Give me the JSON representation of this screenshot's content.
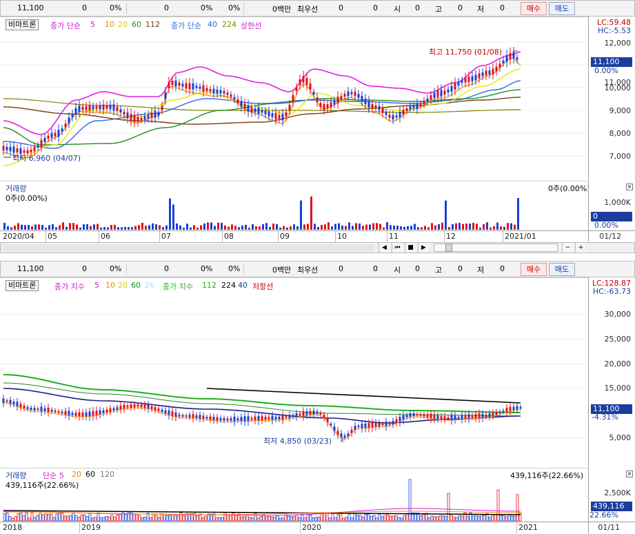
{
  "top": {
    "quote": {
      "price": "11,100",
      "chg": "0",
      "chg_pct": "0%",
      "vol": "0",
      "vol_pct": "0%",
      "pct2": "0%",
      "amount": "0백만",
      "best_bid_label": "최우선",
      "bid1": "0",
      "bid2": "0",
      "open_label": "시",
      "open": "0",
      "high_label": "고",
      "high": "0",
      "low_label": "저",
      "low": "0",
      "buy": "매수",
      "sell": "매도"
    },
    "legend": {
      "chart_type": "비마트론",
      "ma_label": "종가 단순",
      "ma5": "5",
      "ma10": "10",
      "ma20": "20",
      "ma60": "60",
      "ma112": "112",
      "ma2_label": "종가 단순",
      "ma40": "40",
      "ma224": "224",
      "upper": "상한선"
    },
    "lc": "LC:59.48",
    "hc": "HC:-5.53",
    "y_ticks": [
      "12,000",
      "11,000",
      "10,000",
      "9,000",
      "8,000",
      "7,000"
    ],
    "price_box": "11,100",
    "price_pct": "0.00%",
    "high_annot": "최고 11,750 (01/08)",
    "low_annot": "최저 6,960 (04/07)",
    "volume": {
      "title": "거래량",
      "left_val": "0주(0.00%)",
      "right_val": "0주(0.00%)",
      "tick": "1,000K",
      "box": "0",
      "pct": "0.00%"
    },
    "x_labels": [
      "2020/04",
      "05",
      "06",
      "07",
      "08",
      "09",
      "10",
      "11",
      "12",
      "2021/01"
    ],
    "date_box": "01/12",
    "scroll_buttons": [
      "◀",
      "⏮",
      "■",
      "▶",
      "−",
      "+"
    ]
  },
  "bottom": {
    "quote": {
      "price": "11,100",
      "chg": "0",
      "chg_pct": "0%",
      "vol": "0",
      "vol_pct": "0%",
      "pct2": "0%",
      "amount": "0백만",
      "best_bid_label": "최우선",
      "bid1": "0",
      "bid2": "0",
      "open_label": "시",
      "open": "0",
      "high_label": "고",
      "high": "0",
      "low_label": "저",
      "low": "0",
      "buy": "매수",
      "sell": "매도"
    },
    "legend": {
      "chart_type": "비마트론",
      "ma_label": "종가 지수",
      "ma5": "5",
      "ma10": "10",
      "ma20": "20",
      "ma60": "60",
      "ma26": "26",
      "ma2_label": "종가 지수",
      "ma112": "112",
      "ma224": "224",
      "ma40": "40",
      "resist": "저항선"
    },
    "lc": "LC:128.87",
    "hc": "HC:-63.73",
    "y_ticks": [
      "30,000",
      "25,000",
      "20,000",
      "15,000",
      "5,000"
    ],
    "price_box": "11,100",
    "price_pct": "-4.31%",
    "low_annot": "최저 4,850 (03/23)",
    "volume": {
      "title": "거래량",
      "ma_label": "단순 5",
      "ma20": "20",
      "ma60": "60",
      "ma120": "120",
      "left_val": "439,116주(22.66%)",
      "right_val": "439,116주(22.66%)",
      "tick": "2,500K",
      "box": "439,116",
      "pct": "22.66%"
    },
    "x_labels": [
      "2018",
      "2019",
      "2020",
      "2021"
    ],
    "date_box": "01/11"
  },
  "colors": {
    "up": "#e0101a",
    "down": "#1a3fd6",
    "ma5": "#e01ad8",
    "ma10": "#ff8c00",
    "ma20": "#e8e800",
    "ma60": "#1e8f1e",
    "ma112": "#7a3b0b",
    "ma40": "#2a6ae0",
    "ma224": "#808000",
    "upper": "#e020e0"
  }
}
